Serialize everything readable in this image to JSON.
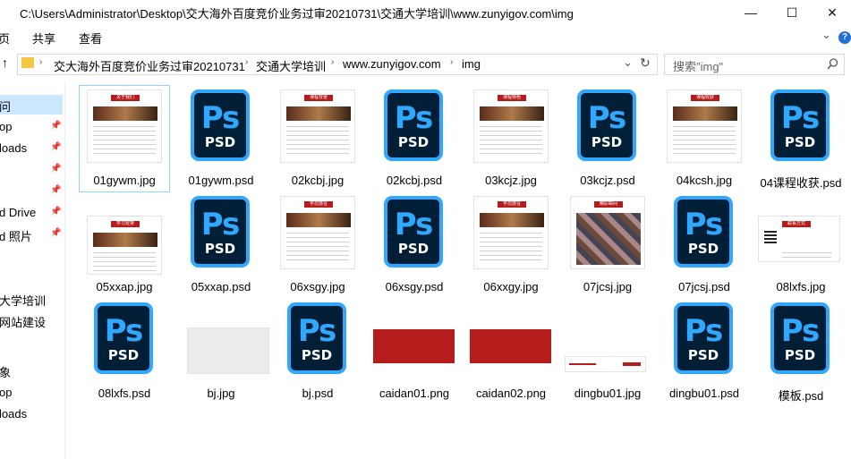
{
  "window": {
    "title": "C:\\Users\\Administrator\\Desktop\\交大海外百度竞价业务过审20210731\\交通大学培训\\www.zunyigov.com\\img",
    "minimize": "—",
    "maximize": "☐",
    "close": "✕"
  },
  "ribbon": {
    "tabs": [
      "页",
      "共享",
      "查看"
    ],
    "expand": "⌄",
    "help": "?"
  },
  "address": {
    "up": "↑",
    "crumbs": [
      "交大海外百度竞价业务过审20210731",
      "交通大学培训",
      "www.zunyigov.com",
      "img"
    ],
    "dropdown": "⌄",
    "refresh": "↻",
    "search_placeholder": "搜索\"img\""
  },
  "sidebar": {
    "items": [
      {
        "label": "问",
        "pinned": false
      },
      {
        "label": "op",
        "pinned": true
      },
      {
        "label": "loads",
        "pinned": true
      },
      {
        "label": "",
        "pinned": true
      },
      {
        "label": "",
        "pinned": true
      },
      {
        "label": "d Drive",
        "pinned": true
      },
      {
        "label": "d 照片",
        "pinned": true
      },
      {
        "label": "",
        "pinned": false
      },
      {
        "label": "大学培训",
        "pinned": false
      },
      {
        "label": "网站建设",
        "pinned": false
      },
      {
        "label": "",
        "pinned": false
      },
      {
        "label": "象",
        "pinned": false
      },
      {
        "label": "op",
        "pinned": false
      },
      {
        "label": "loads",
        "pinned": false
      }
    ],
    "pin_glyph": "📌"
  },
  "psd_icon": {
    "big": "Ps",
    "small": "PSD",
    "accent": "#31a8ff",
    "bg": "#001e36"
  },
  "files": [
    {
      "name": "01gywm.jpg",
      "kind": "jpg",
      "selected": true
    },
    {
      "name": "01gywm.psd",
      "kind": "psd"
    },
    {
      "name": "02kcbj.jpg",
      "kind": "jpg"
    },
    {
      "name": "02kcbj.psd",
      "kind": "psd"
    },
    {
      "name": "03kcjz.jpg",
      "kind": "jpg"
    },
    {
      "name": "03kcjz.psd",
      "kind": "psd"
    },
    {
      "name": "04kcsh.jpg",
      "kind": "jpg"
    },
    {
      "name": "04课程收获.psd",
      "kind": "psd"
    },
    {
      "name": "05xxap.jpg",
      "kind": "jpg"
    },
    {
      "name": "05xxap.psd",
      "kind": "psd"
    },
    {
      "name": "06xsgy.jpg",
      "kind": "jpg"
    },
    {
      "name": "06xsgy.psd",
      "kind": "psd"
    },
    {
      "name": "06xxgy.jpg",
      "kind": "jpg"
    },
    {
      "name": "07jcsj.jpg",
      "kind": "jpg"
    },
    {
      "name": "07jcsj.psd",
      "kind": "psd"
    },
    {
      "name": "08lxfs.jpg",
      "kind": "jpg"
    },
    {
      "name": "08lxfs.psd",
      "kind": "psd"
    },
    {
      "name": "bj.jpg",
      "kind": "jpg"
    },
    {
      "name": "bj.psd",
      "kind": "psd"
    },
    {
      "name": "caidan01.png",
      "kind": "png"
    },
    {
      "name": "caidan02.png",
      "kind": "png"
    },
    {
      "name": "dingbu01.jpg",
      "kind": "jpg"
    },
    {
      "name": "dingbu01.psd",
      "kind": "psd"
    },
    {
      "name": "模板.psd",
      "kind": "psd"
    }
  ],
  "thumb_headers": {
    "t0": "关于我们",
    "t2": "课程背景",
    "t4": "课程特色",
    "t6": "课程收获",
    "t8": "学习安排",
    "t10": "学员感言",
    "t12": "学员感言",
    "t13": "精彩瞬间",
    "t15": "联系方式"
  },
  "colors": {
    "brand_red": "#b51d1d",
    "selection": "#cce8ff",
    "psd_border": "#31a8ff"
  }
}
